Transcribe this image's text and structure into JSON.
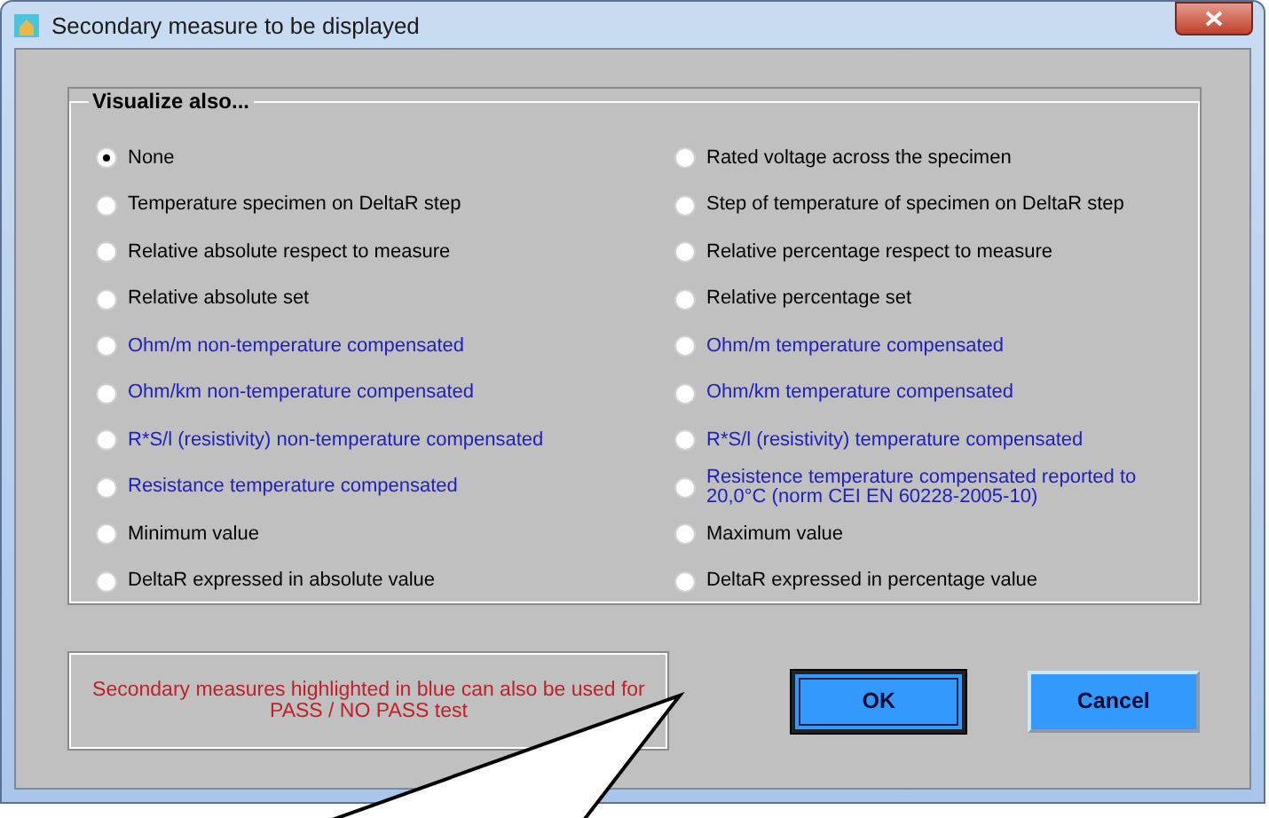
{
  "window": {
    "title": "Secondary measure to be displayed"
  },
  "group": {
    "title": "Visualize also...",
    "options": [
      {
        "label": "None",
        "selected": true,
        "color": "#000000"
      },
      {
        "label": "Rated voltage across the specimen",
        "selected": false,
        "color": "#000000"
      },
      {
        "label": "Temperature specimen on DeltaR step",
        "selected": false,
        "color": "#000000"
      },
      {
        "label": "Step of temperature of specimen on DeltaR step",
        "selected": false,
        "color": "#000000"
      },
      {
        "label": "Relative absolute respect to measure",
        "selected": false,
        "color": "#000000"
      },
      {
        "label": "Relative percentage respect to measure",
        "selected": false,
        "color": "#000000"
      },
      {
        "label": "Relative absolute set",
        "selected": false,
        "color": "#000000"
      },
      {
        "label": "Relative percentage set",
        "selected": false,
        "color": "#000000"
      },
      {
        "label": "Ohm/m non-temperature compensated",
        "selected": false,
        "color": "#2020c0"
      },
      {
        "label": "Ohm/m temperature compensated",
        "selected": false,
        "color": "#2020c0"
      },
      {
        "label": "Ohm/km non-temperature compensated",
        "selected": false,
        "color": "#2020c0"
      },
      {
        "label": "Ohm/km temperature compensated",
        "selected": false,
        "color": "#2020c0"
      },
      {
        "label": "R*S/l (resistivity) non-temperature compensated",
        "selected": false,
        "color": "#2020c0"
      },
      {
        "label": "R*S/l (resistivity) temperature compensated",
        "selected": false,
        "color": "#2020c0"
      },
      {
        "label": "Resistance temperature compensated",
        "selected": false,
        "color": "#2020c0"
      },
      {
        "label": "Resistence temperature compensated reported to 20,0°C (norm CEI EN 60228-2005-10)",
        "selected": false,
        "color": "#2020c0"
      },
      {
        "label": "Minimum value",
        "selected": false,
        "color": "#000000"
      },
      {
        "label": "Maximum value",
        "selected": false,
        "color": "#000000"
      },
      {
        "label": "DeltaR expressed in absolute value",
        "selected": false,
        "color": "#000000"
      },
      {
        "label": "DeltaR expressed in percentage value",
        "selected": false,
        "color": "#000000"
      }
    ]
  },
  "note": "Secondary measures highlighted in blue can also be used for PASS / NO PASS test",
  "buttons": [
    {
      "label": "OK",
      "focused": true
    },
    {
      "label": "Cancel",
      "focused": false
    }
  ]
}
